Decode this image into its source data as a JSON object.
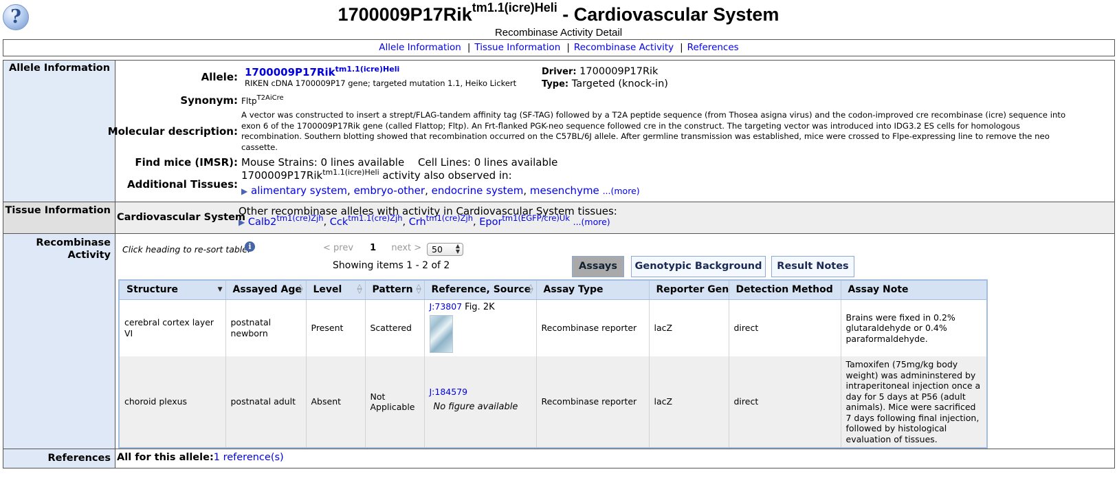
{
  "header": {
    "title_prefix": "1700009P17Rik",
    "title_sup": "tm1.1(icre)Heli",
    "title_suffix": " - Cardiovascular System",
    "subtitle": "Recombinase Activity Detail",
    "help_glyph": "?"
  },
  "nav": [
    {
      "label": "Allele Information"
    },
    {
      "label": "Tissue Information"
    },
    {
      "label": "Recombinase Activity"
    },
    {
      "label": "References"
    }
  ],
  "sections": {
    "allele": "Allele Information",
    "tissue": "Tissue Information",
    "recombinase": "Recombinase Activity",
    "references": "References"
  },
  "allele": {
    "allele_label": "Allele:",
    "symbol": "1700009P17Rik",
    "symbol_sup": "tm1.1(icre)Heli",
    "name": "RIKEN cDNA 1700009P17 gene; targeted mutation 1.1, Heiko Lickert",
    "driver_label": "Driver:",
    "driver": "1700009P17Rik",
    "type_label": "Type:",
    "type": "Targeted (knock-in)",
    "synonym_label": "Synonym:",
    "synonym": "Fltp",
    "synonym_sup": "T2AiCre",
    "molecular_label": "Molecular description:",
    "molecular": "A vector was constructed to insert a strept/FLAG-tandem affinity tag (SF-TAG) followed by a T2A peptide sequence (from Thosea asigna virus) and the codon-improved cre recombinase (icre) sequence into exon 6 of the 1700009P17Rik gene (called Flattop; Fltp). An Frt-flanked PGK-neo sequence followed cre in the construct. The targeting vector was introduced into IDG3.2 ES cells for homologous recombination. Southern blotting showed that recombination occurred on the C57BL/6J allele. After germline transmission was established, mice were crossed to Flpe-expressing line to remove the neo cassette.",
    "findmice_label": "Find mice (IMSR):",
    "mouse_strains": "Mouse Strains: 0 lines available",
    "cell_lines": "Cell Lines: 0 lines available",
    "additional_label": "Additional Tissues:",
    "additional_prefix": "1700009P17Rik",
    "additional_sup": "tm1.1(icre)Heli",
    "additional_text": " activity also observed in:",
    "tissues": [
      "alimentary system",
      "embryo-other",
      "endocrine system",
      "mesenchyme"
    ],
    "more": "...(more)"
  },
  "tissue": {
    "name": "Cardiovascular System",
    "intro": "Other recombinase alleles with activity in Cardiovascular System tissues:",
    "alleles": [
      {
        "gene": "Calb2",
        "sup": "tm1(cre)Zjh"
      },
      {
        "gene": "Cck",
        "sup": "tm1.1(cre)Zjh"
      },
      {
        "gene": "Crh",
        "sup": "tm1(cre)Zjh"
      },
      {
        "gene": "Epor",
        "sup": "tm1(EGFP/cre)Uk"
      }
    ],
    "more": "...(more)"
  },
  "recombinase": {
    "hint": "Click heading to re-sort table.",
    "info_glyph": "i",
    "prev": "< prev",
    "page": "1",
    "next": "next >",
    "page_size": "50",
    "showing": "Showing items 1 - 2 of 2",
    "tabs": [
      "Assays",
      "Genotypic Background",
      "Result Notes"
    ],
    "columns": [
      "Structure",
      "Assayed Age",
      "Level",
      "Pattern",
      "Reference, Source",
      "Assay Type",
      "Reporter Gene",
      "Detection Method",
      "Assay Note"
    ],
    "rows": [
      {
        "structure": "cerebral cortex layer VI",
        "age": "postnatal newborn",
        "level": "Present",
        "pattern": "Scattered",
        "ref": "J:73807",
        "source": "Fig. 2K",
        "assay_type": "Recombinase reporter",
        "reporter": "lacZ",
        "detection": "direct",
        "note": "Brains were fixed in 0.2% glutaraldehyde or 0.4% paraformaldehyde."
      },
      {
        "structure": "choroid plexus",
        "age": "postnatal adult",
        "level": "Absent",
        "pattern": "Not Applicable",
        "ref": "J:184579",
        "source": "No figure available",
        "assay_type": "Recombinase reporter",
        "reporter": "lacZ",
        "detection": "direct",
        "note": "Tamoxifen (75mg/kg body weight) was admininstered by intraperitoneal injection once a day for 5 days at P56 (adult animals). Mice were sacrificed 7 days following final injection, followed by histological evaluation of tissues."
      }
    ]
  },
  "references": {
    "label": "All for this allele:",
    "link": "1 reference(s)"
  }
}
